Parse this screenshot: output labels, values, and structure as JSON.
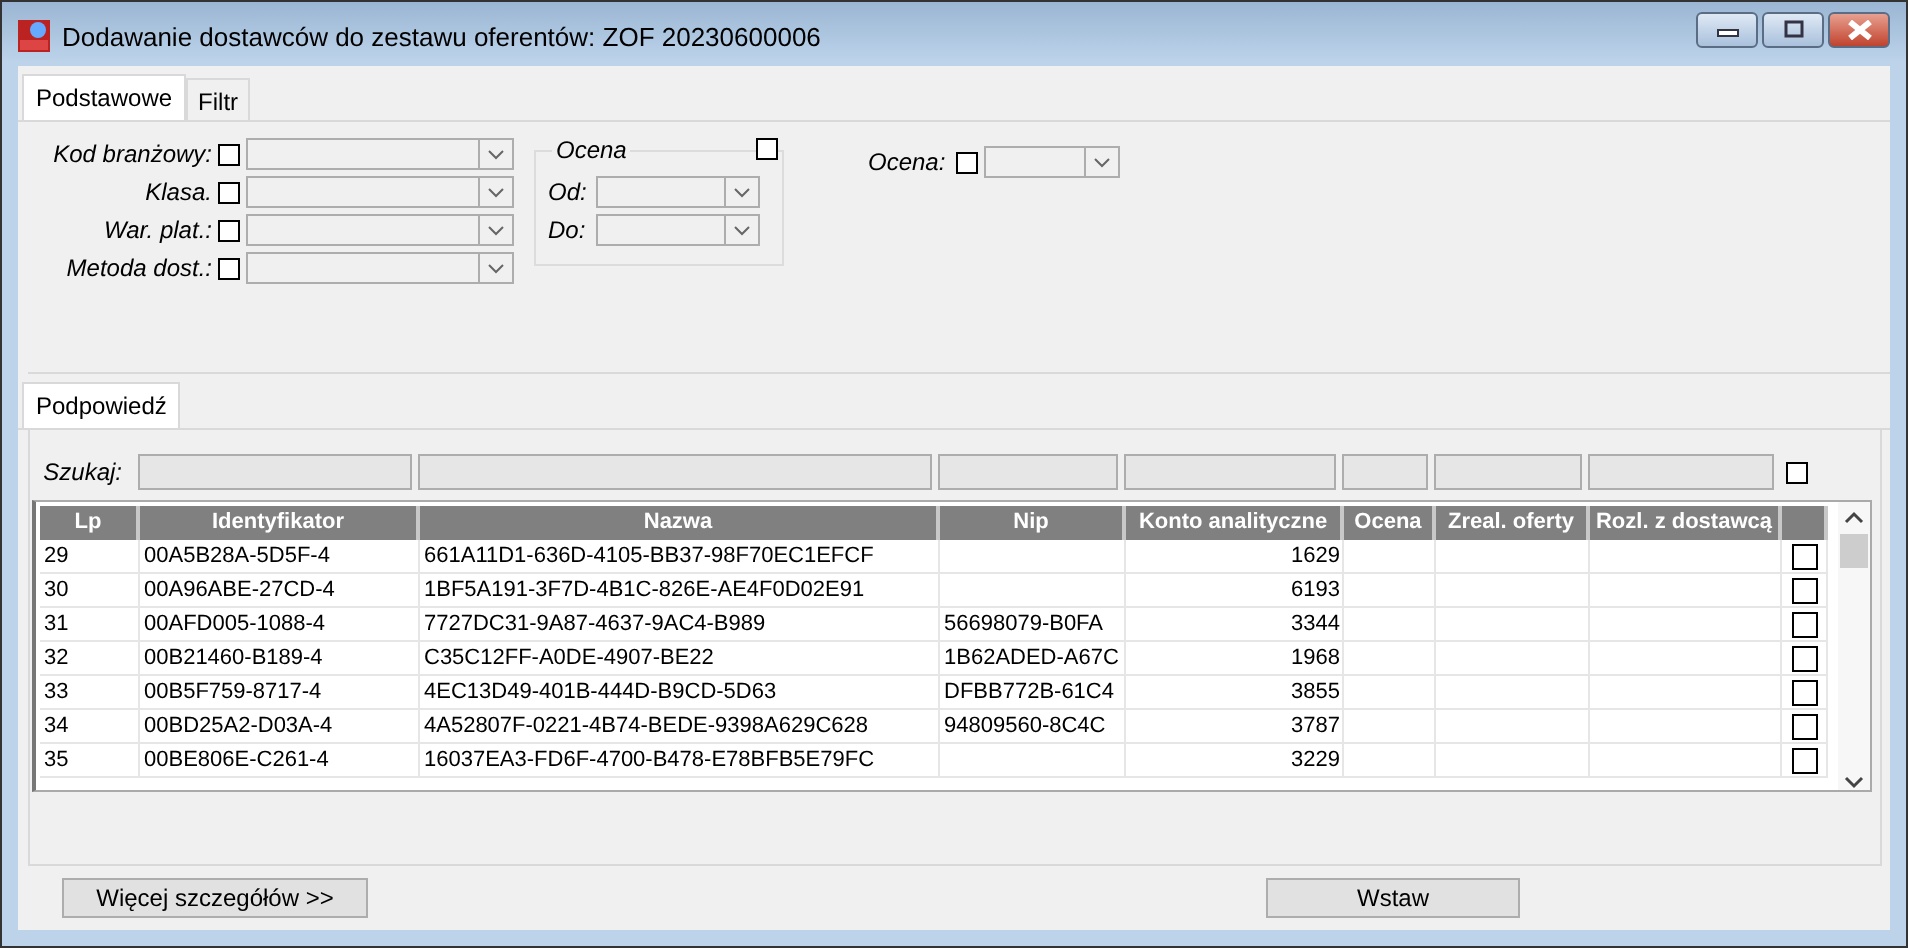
{
  "window": {
    "title": "Dodawanie dostawców do zestawu oferentów:  ZOF 20230600006"
  },
  "tabs": [
    {
      "label": "Podstawowe",
      "selected": true
    },
    {
      "label": "Filtr",
      "selected": false
    }
  ],
  "filters": [
    {
      "label": "Kod branżowy:",
      "checked": false
    },
    {
      "label": "Klasa.",
      "checked": false
    },
    {
      "label": "War. plat.:",
      "checked": false
    },
    {
      "label": "Metoda dost.:",
      "checked": false
    }
  ],
  "grade_group": {
    "title": "Ocena",
    "checked": false,
    "from_label": "Od:",
    "to_label": "Do:"
  },
  "grade_filter": {
    "label": "Ocena:",
    "checked": false
  },
  "hint_tabs": [
    {
      "label": "Podpowiedź",
      "selected": true
    }
  ],
  "search": {
    "label": "Szukaj:",
    "checked": false
  },
  "table": {
    "columns": [
      "Lp",
      "Identyfikator",
      "Nazwa",
      "Nip",
      "Konto analityczne",
      "Ocena",
      "Zreal. oferty",
      "Rozl. z dostawcą"
    ],
    "rows": [
      {
        "cells": [
          "29",
          "00A5B28A-5D5F-4",
          "661A11D1-636D-4105-BB37-98F70EC1EFCF",
          "",
          "1629",
          "",
          "",
          ""
        ],
        "checked": false
      },
      {
        "cells": [
          "30",
          "00A96ABE-27CD-4",
          "1BF5A191-3F7D-4B1C-826E-AE4F0D02E91",
          "",
          "6193",
          "",
          "",
          ""
        ],
        "checked": false
      },
      {
        "cells": [
          "31",
          "00AFD005-1088-4",
          "7727DC31-9A87-4637-9AC4-B989",
          "56698079-B0FA",
          "3344",
          "",
          "",
          ""
        ],
        "checked": false
      },
      {
        "cells": [
          "32",
          "00B21460-B189-4",
          "C35C12FF-A0DE-4907-BE22",
          "1B62ADED-A67C",
          "1968",
          "",
          "",
          ""
        ],
        "checked": false
      },
      {
        "cells": [
          "33",
          "00B5F759-8717-4",
          "4EC13D49-401B-444D-B9CD-5D63",
          "DFBB772B-61C4",
          "3855",
          "",
          "",
          ""
        ],
        "checked": false
      },
      {
        "cells": [
          "34",
          "00BD25A2-D03A-4",
          "4A52807F-0221-4B74-BEDE-9398A629C628",
          "94809560-8C4C",
          "3787",
          "",
          "",
          ""
        ],
        "checked": false
      },
      {
        "cells": [
          "35",
          "00BE806E-C261-4",
          "16037EA3-FD6F-4700-B478-E78BFB5E79FC",
          "",
          "3229",
          "",
          "",
          ""
        ],
        "checked": false
      }
    ]
  },
  "buttons": [
    {
      "label": "Więcej szczegółów >>"
    },
    {
      "label": "Wstaw"
    }
  ]
}
